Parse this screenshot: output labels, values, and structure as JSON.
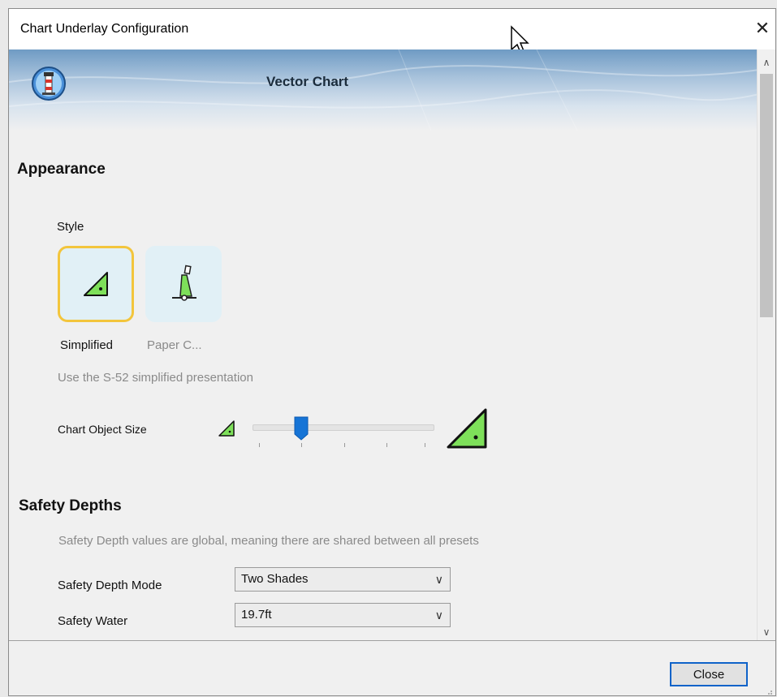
{
  "window": {
    "title": "Chart Underlay Configuration",
    "close_glyph": "✕"
  },
  "banner": {
    "title": "Vector Chart",
    "icon": "lighthouse-icon"
  },
  "appearance": {
    "heading": "Appearance",
    "style_label": "Style",
    "styles": [
      {
        "label": "Simplified",
        "icon": "simplified-buoy-icon",
        "selected": true
      },
      {
        "label": "Paper C...",
        "icon": "paper-chart-buoy-icon",
        "selected": false
      }
    ],
    "description": "Use the S-52 simplified presentation",
    "object_size_label": "Chart Object Size",
    "object_size_level": 0.27
  },
  "safety": {
    "heading": "Safety Depths",
    "note": "Safety Depth values are global, meaning there are shared between all presets",
    "mode_label": "Safety Depth Mode",
    "mode_value": "Two Shades",
    "water_label": "Safety Water",
    "water_value": "19.7ft"
  },
  "footer": {
    "close_label": "Close"
  },
  "colors": {
    "accent": "#0f63c9",
    "selection": "#f3c53c",
    "buoy_green": "#7ee05a",
    "tile_bg": "#e1f0f6"
  }
}
